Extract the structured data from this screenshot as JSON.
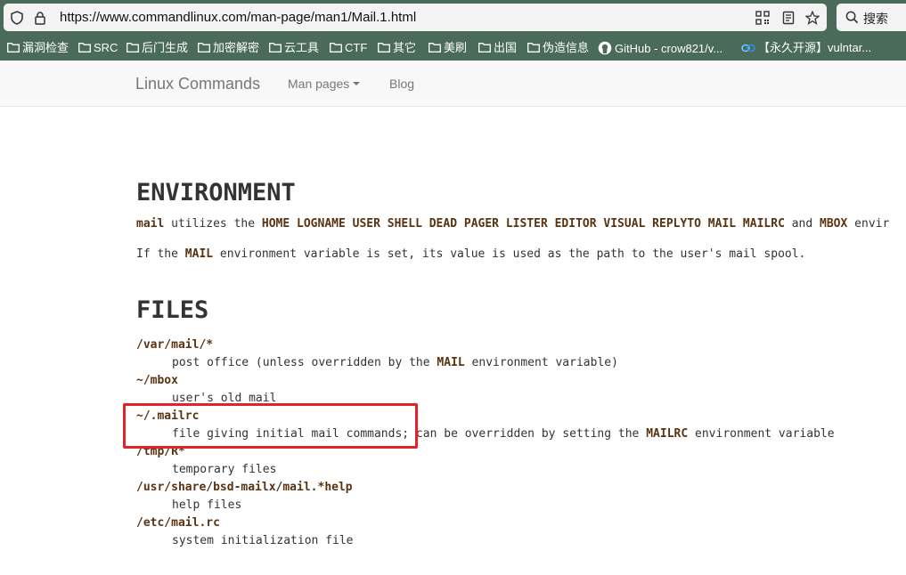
{
  "browser": {
    "url": "https://www.commandlinux.com/man-page/man1/Mail.1.html",
    "search_label": "搜索",
    "accent_color": "#4a6b5a"
  },
  "bookmarks": [
    {
      "label": "漏洞检查",
      "icon": "folder-icon"
    },
    {
      "label": "SRC",
      "icon": "folder-icon"
    },
    {
      "label": "后门生成",
      "icon": "folder-icon"
    },
    {
      "label": "加密解密",
      "icon": "folder-icon"
    },
    {
      "label": "云工具",
      "icon": "folder-icon"
    },
    {
      "label": "CTF",
      "icon": "folder-icon"
    },
    {
      "label": "其它",
      "icon": "folder-icon"
    },
    {
      "label": "美刷",
      "icon": "folder-icon"
    },
    {
      "label": "出国",
      "icon": "folder-icon"
    },
    {
      "label": "伪造信息",
      "icon": "folder-icon"
    },
    {
      "label": "GitHub - crow821/v...",
      "icon": "github-icon"
    },
    {
      "label": "【永久开源】vulntar...",
      "icon": "link-icon"
    }
  ],
  "navbar": {
    "brand": "Linux Commands",
    "man_pages": "Man pages",
    "blog": "Blog"
  },
  "environment": {
    "heading": "ENVIRONMENT",
    "p1_cmd": "mail",
    "p1_text": " utilizes the ",
    "p1_vars": "HOME LOGNAME USER SHELL DEAD PAGER LISTER EDITOR VISUAL REPLYTO MAIL MAILRC",
    "p1_and": " and ",
    "p1_mbox": "MBOX",
    "p1_tail": " envir",
    "p2_a": "If the ",
    "p2_var": "MAIL",
    "p2_b": " environment variable is set, its value is used as the path to the user's mail spool."
  },
  "files": {
    "heading": "FILES",
    "f1": "/var/mail/*",
    "f1_desc_a": "post office (unless overridden by the ",
    "f1_desc_var": "MAIL",
    "f1_desc_b": " environment variable)",
    "f2": "~/mbox",
    "f2_desc": "user's old mail",
    "f3": "~/.mailrc",
    "f3_desc_a": "file giving initial mail commands; can be overridden by setting the ",
    "f3_desc_var": "MAILRC",
    "f3_desc_b": " environment variable",
    "f4": "/tmp/R*",
    "f4_desc": "temporary files",
    "f5": "/usr/share/bsd-mailx/mail.*help",
    "f5_desc": "help files",
    "f6": "/etc/mail.rc",
    "f6_desc": "system initialization file"
  }
}
